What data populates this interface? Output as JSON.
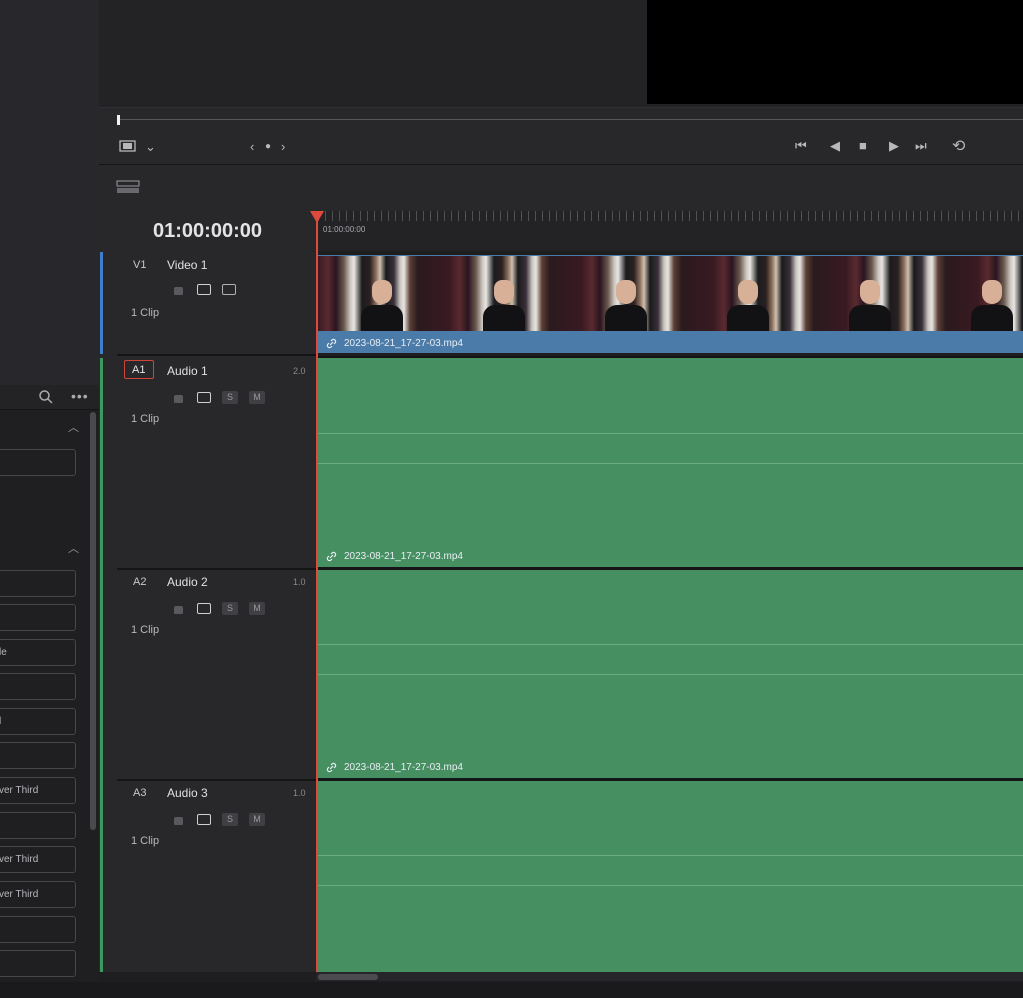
{
  "timecode": "01:00:00:00",
  "ruler_label": "01:00:00:00",
  "tracks": {
    "v1": {
      "id": "V1",
      "name": "Video 1",
      "clips": "1 Clip",
      "clip_name": "2023-08-21_17-27-03.mp4"
    },
    "a1": {
      "id": "A1",
      "name": "Audio 1",
      "level": "2.0",
      "clips": "1 Clip",
      "clip_name": "2023-08-21_17-27-03.mp4"
    },
    "a2": {
      "id": "A2",
      "name": "Audio 2",
      "level": "1.0",
      "clips": "1 Clip",
      "clip_name": "2023-08-21_17-27-03.mp4"
    },
    "a3": {
      "id": "A3",
      "name": "Audio 3",
      "level": "1.0",
      "clips": "1 Clip"
    }
  },
  "track_buttons": {
    "solo": "S",
    "mute": "M"
  },
  "effects_list": {
    "items": [
      "",
      "",
      "",
      "le",
      "",
      "l",
      "",
      "ver Third",
      "",
      "ver Third",
      "ver Third",
      ""
    ]
  },
  "colors": {
    "video_clip": "#4b7ba8",
    "audio_clip": "#468f61",
    "playhead": "#e04a3c",
    "a1_border": "#d0443a"
  },
  "icons": [
    "search-icon",
    "more-icon",
    "chevron-up-icon",
    "viewer-mode-icon",
    "chevron-down-icon",
    "prev-icon",
    "next-icon",
    "jump-start-icon",
    "reverse-icon",
    "stop-icon",
    "play-icon",
    "jump-end-icon",
    "loop-icon",
    "timeline-view-icon",
    "lock-icon",
    "auto-select-icon",
    "film-icon"
  ]
}
